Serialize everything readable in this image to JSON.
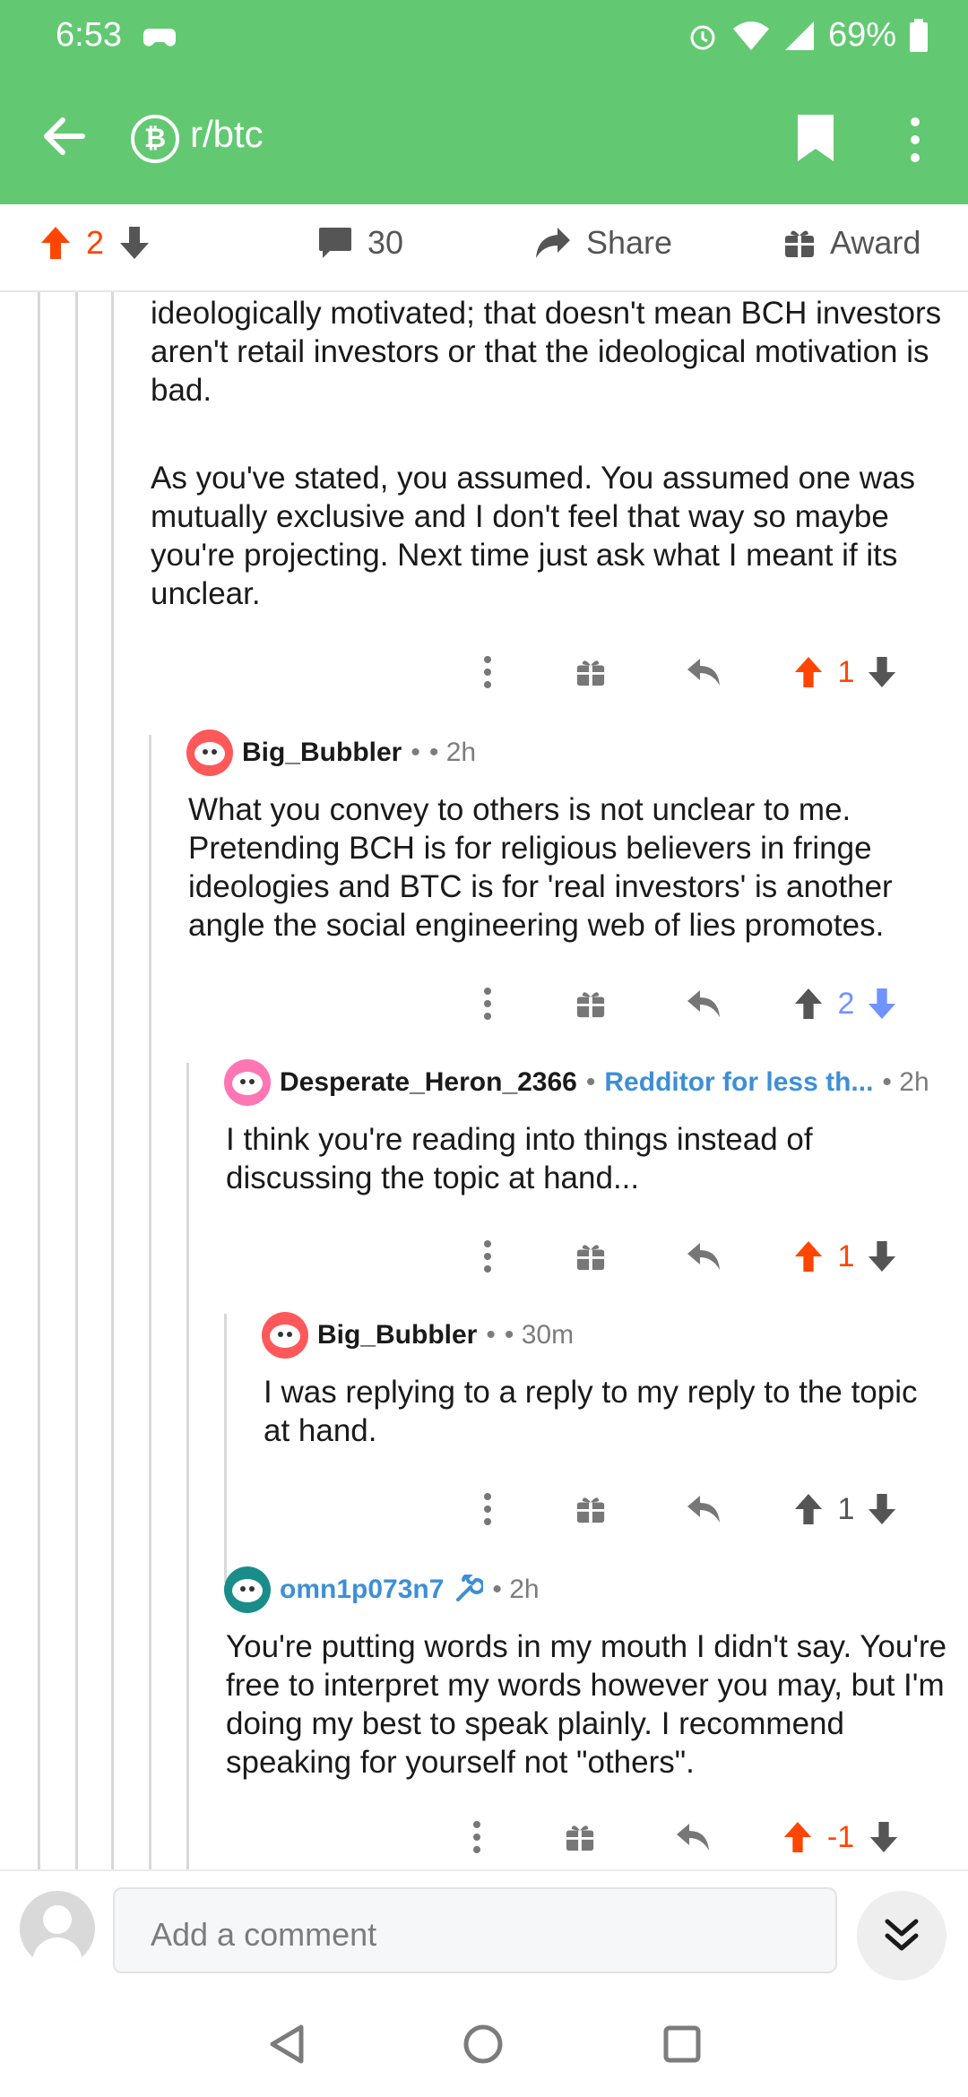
{
  "status_bar": {
    "time": "6:53",
    "battery": "69%"
  },
  "header": {
    "subreddit": "r/btc",
    "subreddit_icon": "bitcoin-icon",
    "back_icon": "arrow-left-icon",
    "bookmark_icon": "bookmark-icon",
    "menu_icon": "kebab-icon"
  },
  "post_actions": {
    "score": "2",
    "comments": "30",
    "share": "Share",
    "award": "Award"
  },
  "comments": [
    {
      "text_p1": "ideologically motivated; that doesn't mean BCH investors aren't retail investors or that the ideological motivation is bad.",
      "text_p2": "As you've stated, you assumed. You assumed one was mutually exclusive and I don't feel that way so maybe you're projecting. Next time just ask what I meant if its unclear.",
      "score": "1",
      "vote": "up"
    },
    {
      "author": "Big_Bubbler",
      "meta": "• 2h",
      "text": "What you convey to others is not unclear to me. Pretending BCH is for religious believers in fringe ideologies and BTC is for 'real investors' is another angle the social engineering web of lies promotes.",
      "score": "2",
      "vote": "down"
    },
    {
      "author": "Desperate_Heron_2366",
      "flair": "Redditor for less th...",
      "meta": "• 2h",
      "text": "I think you're reading into things instead of discussing the topic at hand...",
      "score": "1",
      "vote": "up"
    },
    {
      "author": "Big_Bubbler",
      "meta": "• 30m",
      "text": "I was replying to a reply to my reply to the topic at hand.",
      "score": "1",
      "vote": "none"
    },
    {
      "author": "omn1p073n7",
      "meta": "• 2h",
      "text": "You're putting words in my mouth I didn't say. You're free to interpret my words however you may, but I'm doing my best to speak plainly. I recommend speaking for yourself not \"others\".",
      "score": "-1",
      "vote": "up"
    }
  ],
  "input": {
    "placeholder": "Add a comment"
  },
  "colors": {
    "brand": "#62c972",
    "upvote": "#ff4500",
    "downvote": "#7193ff",
    "link": "#3d8fd6"
  }
}
